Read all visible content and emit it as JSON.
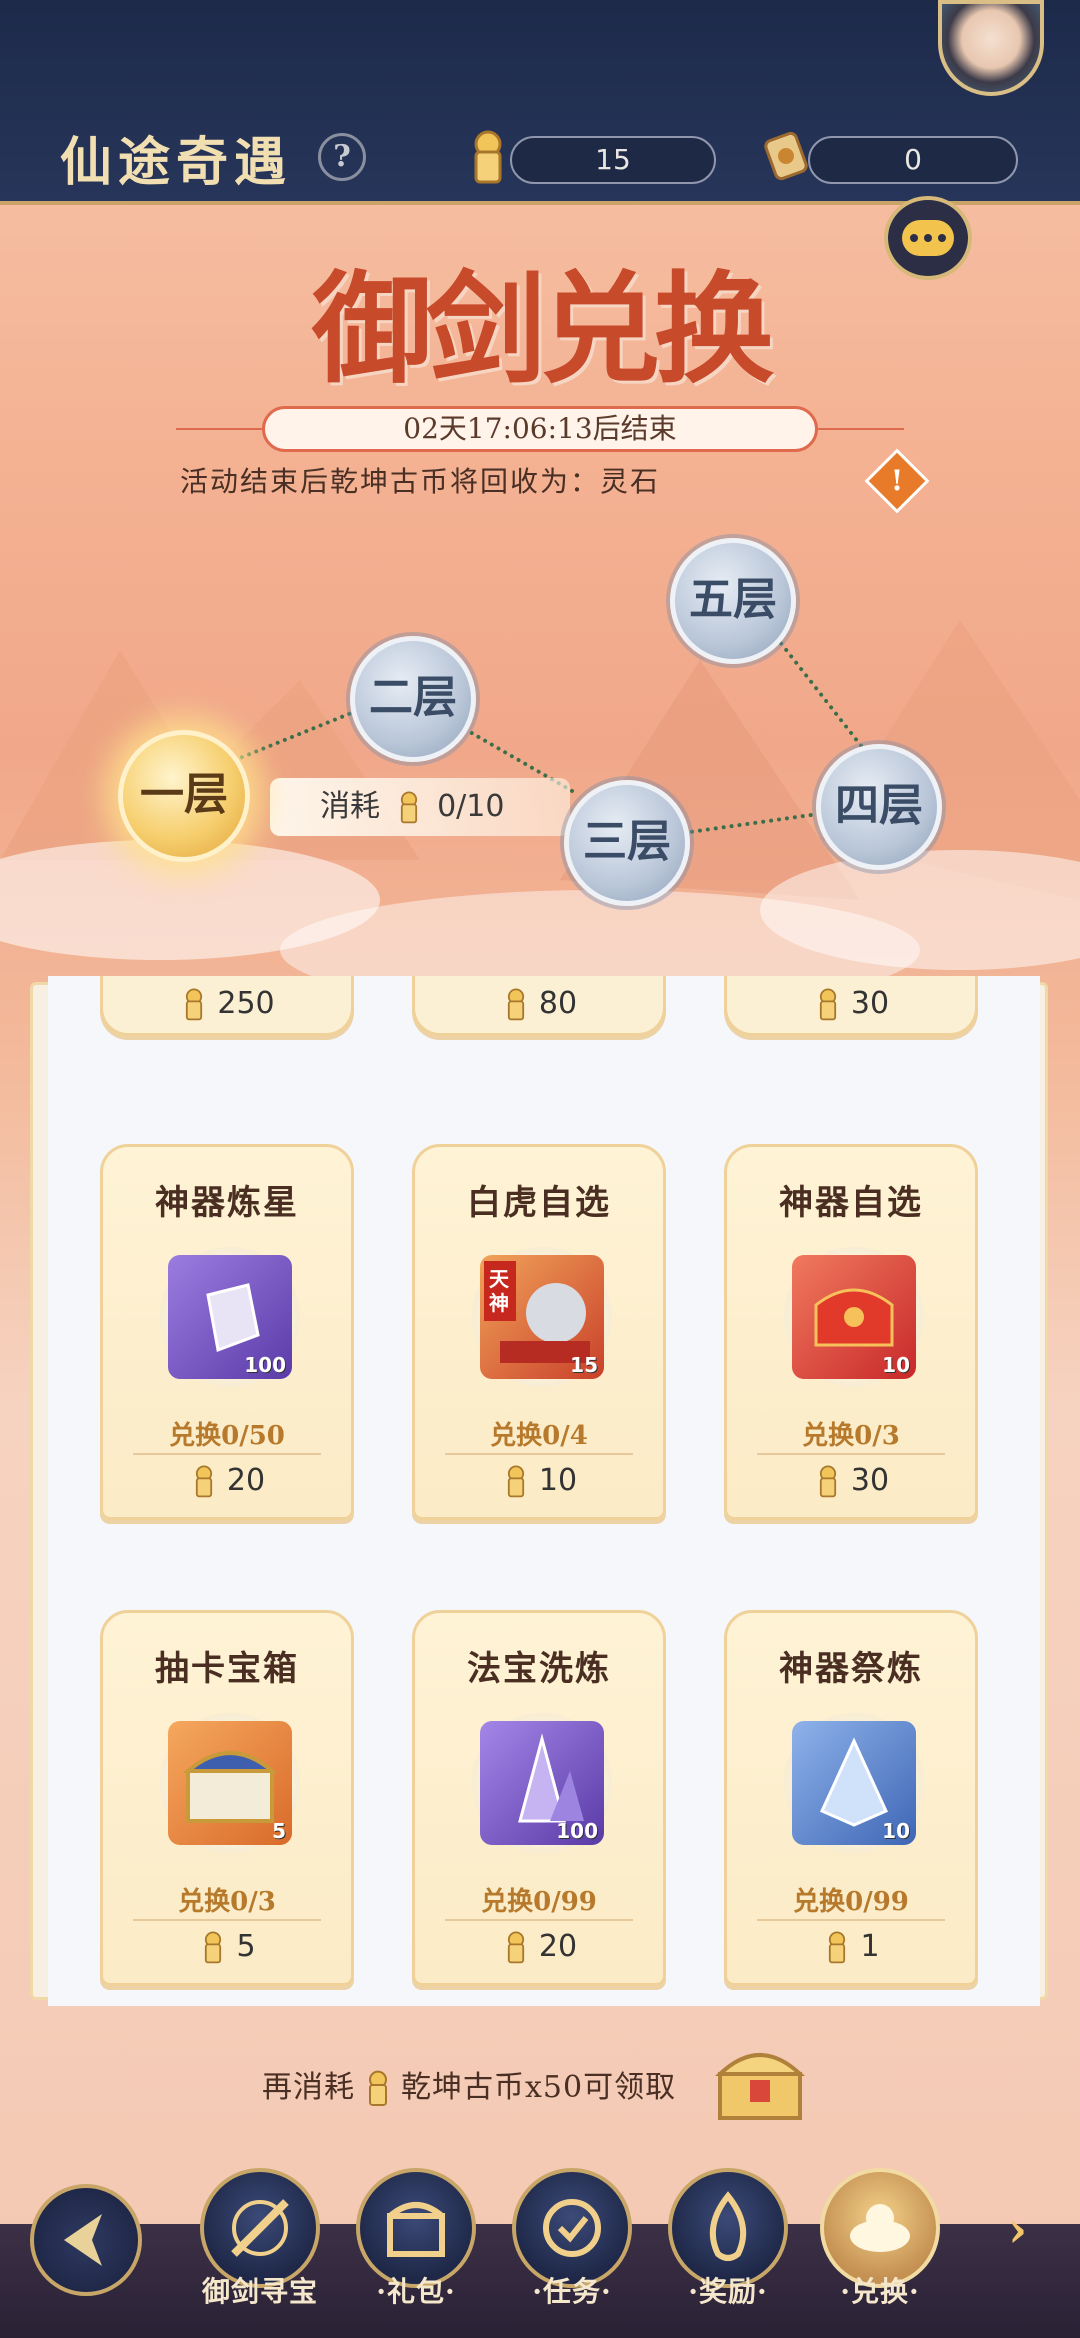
{
  "header": {
    "title": "仙途奇遇",
    "help_icon": "?",
    "currencies": [
      {
        "icon": "qiankun-coin-icon",
        "value": "15"
      },
      {
        "icon": "scroll-token-icon",
        "value": "0"
      }
    ]
  },
  "banner": {
    "title": "御剑兑换",
    "timer": "02天17:06:13后结束",
    "notice": "活动结束后乾坤古币将回收为：灵石",
    "warn_icon": "!"
  },
  "floors": {
    "items": [
      {
        "label": "一层",
        "active": true
      },
      {
        "label": "二层",
        "active": false
      },
      {
        "label": "三层",
        "active": false
      },
      {
        "label": "四层",
        "active": false
      },
      {
        "label": "五层",
        "active": false
      }
    ],
    "cost_label": "消耗",
    "cost_value": "0/10"
  },
  "shop": {
    "top_prices": [
      "250",
      "80",
      "30"
    ],
    "cards": [
      {
        "name": "神器炼星",
        "qty": "100",
        "exchange": "兑换0/50",
        "price": "20",
        "color": "#7b55c9"
      },
      {
        "name": "白虎自选",
        "qty": "15",
        "exchange": "兑换0/4",
        "price": "10",
        "color": "#d9532f",
        "tag": "天神"
      },
      {
        "name": "神器自选",
        "qty": "10",
        "exchange": "兑换0/3",
        "price": "30",
        "color": "#d9432f"
      },
      {
        "name": "抽卡宝箱",
        "qty": "5",
        "exchange": "兑换0/3",
        "price": "5",
        "color": "#e57a2f"
      },
      {
        "name": "法宝洗炼",
        "qty": "100",
        "exchange": "兑换0/99",
        "price": "20",
        "color": "#7b55c9"
      },
      {
        "name": "神器祭炼",
        "qty": "10",
        "exchange": "兑换0/99",
        "price": "1",
        "color": "#4d7bc9"
      }
    ]
  },
  "footer": {
    "prefix": "再消耗",
    "suffix": "乾坤古币x50可领取"
  },
  "nav": {
    "items": [
      {
        "label": "御剑寻宝",
        "selected": false
      },
      {
        "label": "·礼包·",
        "selected": false
      },
      {
        "label": "·任务·",
        "selected": false
      },
      {
        "label": "·奖励·",
        "selected": false
      },
      {
        "label": "·兑换·",
        "selected": true
      }
    ]
  }
}
